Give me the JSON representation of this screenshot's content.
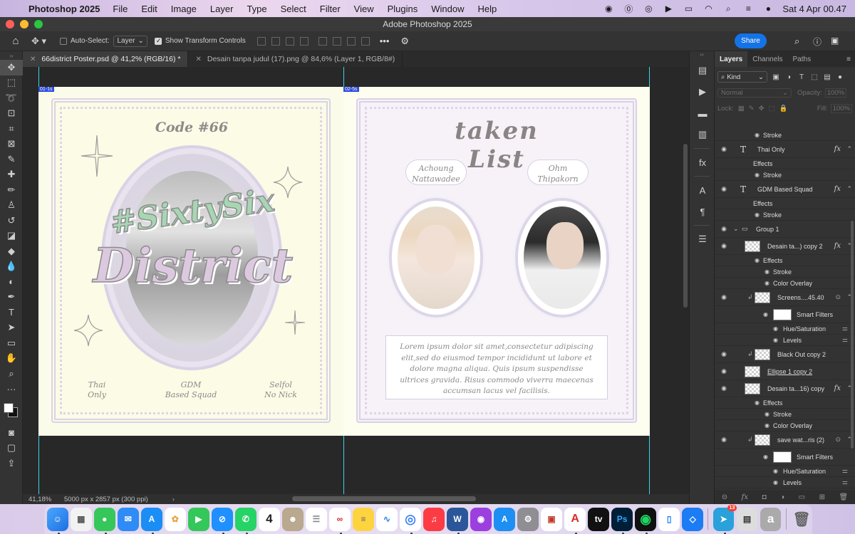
{
  "menubar": {
    "app_name": "Photoshop 2025",
    "items": [
      "File",
      "Edit",
      "Image",
      "Layer",
      "Type",
      "Select",
      "Filter",
      "View",
      "Plugins",
      "Window",
      "Help"
    ],
    "clock": "Sat 4 Apr  00.47"
  },
  "window": {
    "title": "Adobe Photoshop 2025"
  },
  "options": {
    "auto_select_label": "Auto-Select:",
    "auto_select_value": "Layer",
    "show_transform_label": "Show Transform Controls",
    "share_label": "Share"
  },
  "tabs": [
    {
      "label": "66district Poster.psd @ 41,2% (RGB/16) *",
      "active": true
    },
    {
      "label": "Desain tanpa judul (17).png @ 84,6% (Layer 1, RGB/8#)",
      "active": false
    }
  ],
  "artboards": {
    "left_label": "01-1s",
    "right_label": "02-5s"
  },
  "poster_left": {
    "code_text": "Code #66",
    "hashtag_text": "#SixtySix",
    "district_text": "District",
    "footer": [
      {
        "line1": "Thai",
        "line2": "Only"
      },
      {
        "line1": "GDM",
        "line2": "Based Squad"
      },
      {
        "line1": "Selfol",
        "line2": "No Nick"
      }
    ]
  },
  "poster_right": {
    "title": "taken List",
    "person1": {
      "line1": "Achoung",
      "line2": "Nattawadee"
    },
    "person2": {
      "line1": "Ohm",
      "line2": "Thipakorn"
    },
    "lorem": "Lorem ipsum dolor sit amet,consectetur adipiscing elit,sed do eiusmod tempor incididunt ut labore et dolore magna aliqua. Quis ipsum suspendisse ultrices gravida. Risus commodo viverra maecenas accumsan lacus vel facilisis."
  },
  "status": {
    "zoom": "41,18%",
    "dims": "5000 px x 2857 px (300 ppi)"
  },
  "layers_panel": {
    "tabs": [
      "Layers",
      "Channels",
      "Paths"
    ],
    "filter_kind": "Kind",
    "blend_mode": "Normal",
    "opacity_label": "Opacity:",
    "opacity_value": "100%",
    "lock_label": "Lock:",
    "fill_label": "Fill:",
    "fill_value": "100%",
    "rows": [
      {
        "type": "sub",
        "name": "Stroke"
      },
      {
        "type": "text-layer",
        "name": "Thai Only",
        "fx": "fx"
      },
      {
        "type": "effects",
        "name": "Effects"
      },
      {
        "type": "sub",
        "name": "Stroke"
      },
      {
        "type": "text-layer",
        "name": "GDM  Based Squad",
        "fx": "fx"
      },
      {
        "type": "effects",
        "name": "Effects"
      },
      {
        "type": "sub",
        "name": "Stroke"
      },
      {
        "type": "group",
        "name": "Group 1"
      },
      {
        "type": "layer",
        "name": "Desain ta...) copy 2",
        "fx": "fx"
      },
      {
        "type": "effects",
        "name": "Effects"
      },
      {
        "type": "sub",
        "name": "Stroke"
      },
      {
        "type": "sub",
        "name": "Color Overlay"
      },
      {
        "type": "smart",
        "name": "Screens....45.40"
      },
      {
        "type": "smartfilters",
        "name": "Smart Filters"
      },
      {
        "type": "filter",
        "name": "Hue/Saturation"
      },
      {
        "type": "filter",
        "name": "Levels"
      },
      {
        "type": "smart",
        "name": "Black Out copy 2"
      },
      {
        "type": "layer-link",
        "name": "Ellipse 1 copy 2"
      },
      {
        "type": "layer",
        "name": "Desain ta...16) copy",
        "fx": "fx"
      },
      {
        "type": "effects",
        "name": "Effects"
      },
      {
        "type": "sub",
        "name": "Stroke"
      },
      {
        "type": "sub",
        "name": "Color Overlay"
      },
      {
        "type": "smart",
        "name": "save wat...ris (2)"
      },
      {
        "type": "smartfilters",
        "name": "Smart Filters"
      },
      {
        "type": "filter",
        "name": "Hue/Saturation"
      },
      {
        "type": "filter",
        "name": "Levels"
      }
    ]
  },
  "dock": {
    "calendar_day": "4",
    "telegram_badge": "13",
    "apps": [
      "Finder",
      "Launchpad",
      "Messages",
      "Mail",
      "App Store Connect",
      "Photos",
      "FaceTime",
      "Safari",
      "WhatsApp",
      "Calendar",
      "Contacts",
      "Reminders",
      "Creative Cloud",
      "Notes",
      "Freeform",
      "Chrome",
      "Music",
      "Word",
      "Podcasts",
      "App Store",
      "System Settings",
      "Preview",
      "Acrobat",
      "Apple TV",
      "Photoshop",
      "Spotify",
      "Simulator",
      "Xcode",
      "Telegram",
      "Migration",
      "Text",
      "Trash"
    ]
  }
}
